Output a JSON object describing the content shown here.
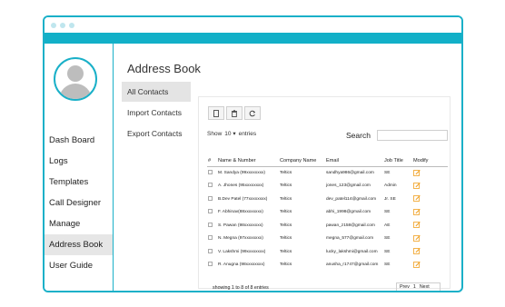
{
  "sidebar": {
    "items": [
      {
        "label": "Dash Board"
      },
      {
        "label": "Logs"
      },
      {
        "label": "Templates"
      },
      {
        "label": "Call Designer"
      },
      {
        "label": "Manage"
      },
      {
        "label": "Address Book"
      },
      {
        "label": "User Guide"
      }
    ],
    "active_index": 5
  },
  "main": {
    "title": "Address Book",
    "subnav": [
      {
        "label": "All Contacts"
      },
      {
        "label": "Import Contacts"
      },
      {
        "label": "Export Contacts"
      }
    ]
  },
  "toolbar": {
    "icons": [
      "new-document-icon",
      "trash-icon",
      "refresh-icon"
    ]
  },
  "list": {
    "show_label": "Show",
    "entries_value": "10",
    "entries_label": "entries",
    "search_label": "Search",
    "search_value": "",
    "columns": [
      "#",
      "Name & Number",
      "Company Name",
      "Email",
      "Job Title",
      "Modify"
    ],
    "rows": [
      {
        "name": "M. Sandya (99xxxxxxxx)",
        "company": "Teltics",
        "email": "sandhya986@gmail.com",
        "job": "SE"
      },
      {
        "name": "A. Jhones (95xxxxxxxx)",
        "company": "Teltics",
        "email": "jones_123@gmail.com",
        "job": "Admin"
      },
      {
        "name": "B.Dev Patel (77xxxxxxxx)",
        "company": "Teltics",
        "email": "dev_patel114@gmail.com",
        "job": "Jr. SE"
      },
      {
        "name": "F. Abhinav(88xxxxxxxx)",
        "company": "Teltics",
        "email": "abhi_1998@gmail.com",
        "job": "SE"
      },
      {
        "name": "S. Pawan (98xxxxxxxx)",
        "company": "Teltics",
        "email": "pawan_z158@gmail.com",
        "job": "AE"
      },
      {
        "name": "N. Megna (97xxxxxxxx)",
        "company": "Teltics",
        "email": "megna_577@gmail.com",
        "job": "SE"
      },
      {
        "name": "V. Lakshmi (99xxxxxxxx)",
        "company": "Teltics",
        "email": "lucky_lakshmi@gmail.com",
        "job": "SE"
      },
      {
        "name": "R. Anugna (98xxxxxxxx)",
        "company": "Teltics",
        "email": "anusha_r1747@gmail.com",
        "job": "SE"
      }
    ],
    "footer_info": "showing 1 to 8 of 8 entries",
    "pager": {
      "prev": "Prev",
      "page": "1",
      "next": "Next"
    }
  },
  "colors": {
    "accent": "#12b0c8",
    "edit_icon": "#f0a020"
  }
}
